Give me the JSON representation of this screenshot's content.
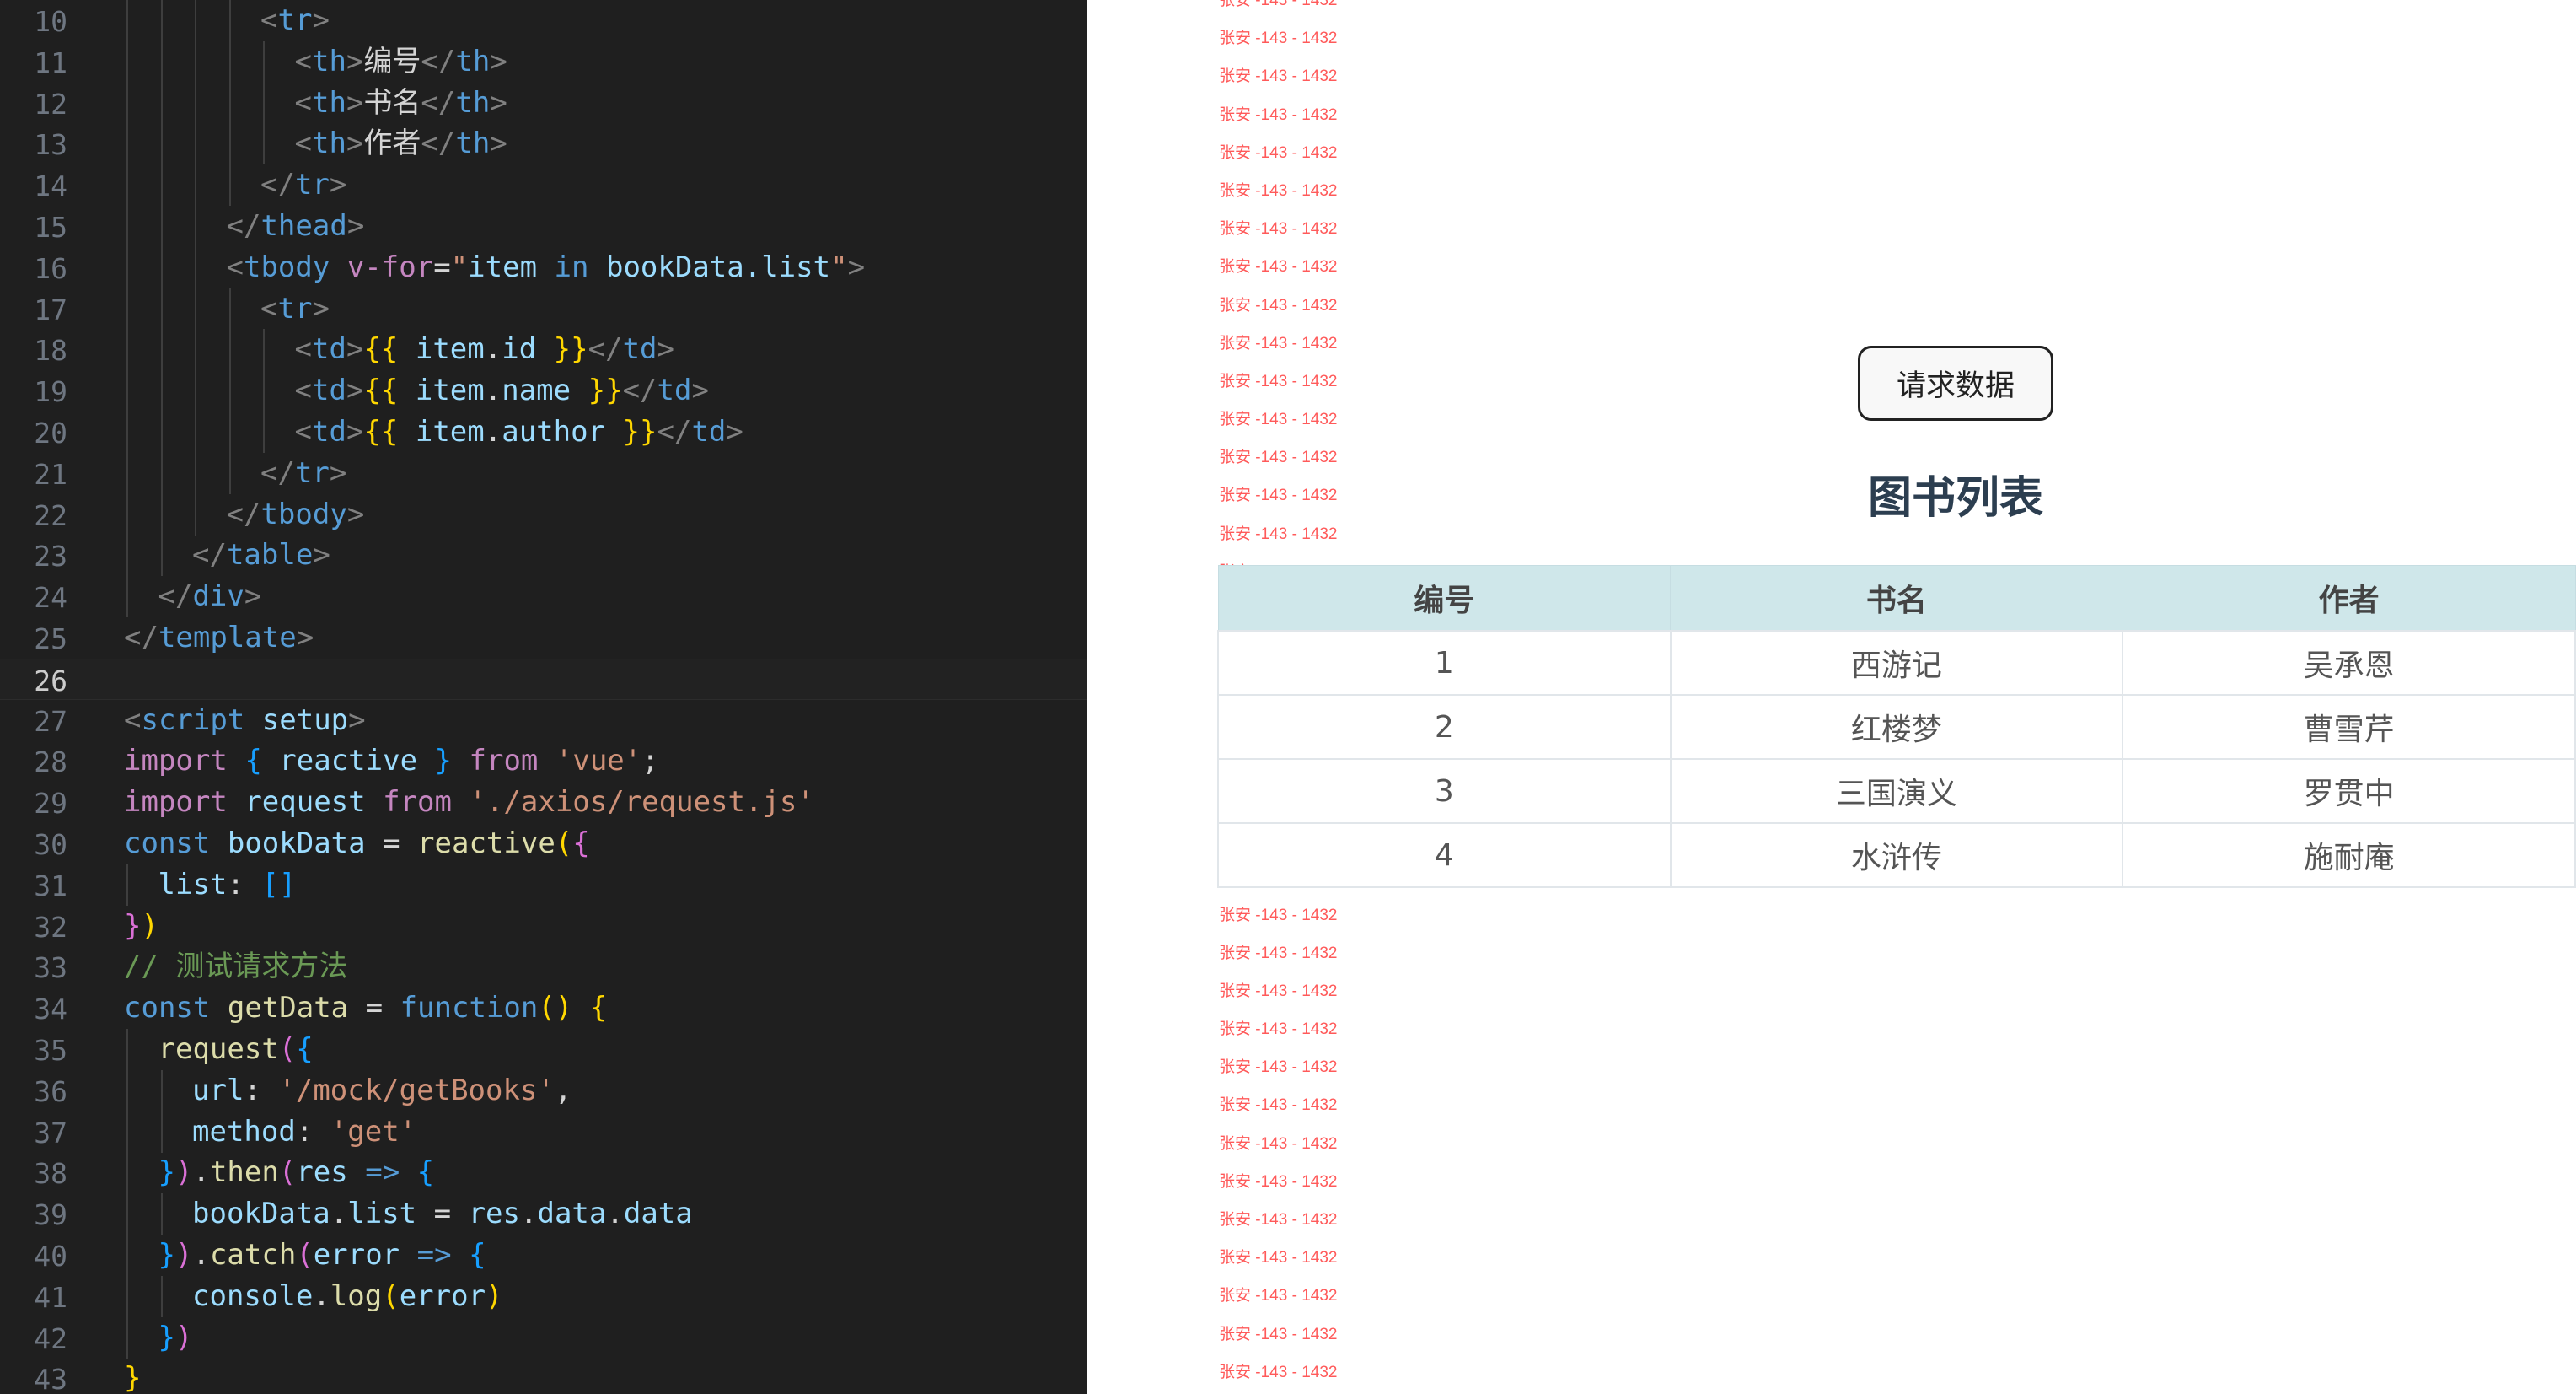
{
  "editor": {
    "lines": [
      {
        "n": "10",
        "indent": 0,
        "tokens": [
          [
            "bracket",
            "<"
          ],
          [
            "tag",
            "tr"
          ],
          [
            "bracket",
            ">"
          ]
        ]
      },
      {
        "n": "11",
        "indent": 0,
        "tokens": [
          [
            "bracket",
            "<"
          ],
          [
            "tag",
            "th"
          ],
          [
            "bracket",
            ">"
          ],
          [
            "plain",
            "编号"
          ],
          [
            "bracket",
            "</"
          ],
          [
            "tag",
            "th"
          ],
          [
            "bracket",
            ">"
          ]
        ]
      },
      {
        "n": "12",
        "indent": 0,
        "tokens": [
          [
            "bracket",
            "<"
          ],
          [
            "tag",
            "th"
          ],
          [
            "bracket",
            ">"
          ],
          [
            "plain",
            "书名"
          ],
          [
            "bracket",
            "</"
          ],
          [
            "tag",
            "th"
          ],
          [
            "bracket",
            ">"
          ]
        ]
      },
      {
        "n": "13",
        "indent": 0,
        "tokens": [
          [
            "bracket",
            "<"
          ],
          [
            "tag",
            "th"
          ],
          [
            "bracket",
            ">"
          ],
          [
            "plain",
            "作者"
          ],
          [
            "bracket",
            "</"
          ],
          [
            "tag",
            "th"
          ],
          [
            "bracket",
            ">"
          ]
        ]
      },
      {
        "n": "14",
        "indent": 0,
        "tokens": [
          [
            "bracket",
            "</"
          ],
          [
            "tag",
            "tr"
          ],
          [
            "bracket",
            ">"
          ]
        ]
      },
      {
        "n": "15",
        "indent": 0,
        "tokens": [
          [
            "bracket",
            "</"
          ],
          [
            "tag",
            "thead"
          ],
          [
            "bracket",
            ">"
          ]
        ]
      },
      {
        "n": "16",
        "indent": 0,
        "tokens": [
          [
            "bracket",
            "<"
          ],
          [
            "tag",
            "tbody"
          ],
          [
            "plain",
            " "
          ],
          [
            "dir",
            "v-for"
          ],
          [
            "plain",
            "="
          ],
          [
            "str",
            "\""
          ],
          [
            "attr",
            "item"
          ],
          [
            "plain",
            " "
          ],
          [
            "kw",
            "in"
          ],
          [
            "plain",
            " "
          ],
          [
            "attr",
            "bookData.list"
          ],
          [
            "str",
            "\""
          ],
          [
            "bracket",
            ">"
          ]
        ]
      },
      {
        "n": "17",
        "indent": 0,
        "tokens": [
          [
            "bracket",
            "<"
          ],
          [
            "tag",
            "tr"
          ],
          [
            "bracket",
            ">"
          ]
        ]
      },
      {
        "n": "18",
        "indent": 0,
        "tokens": [
          [
            "bracket",
            "<"
          ],
          [
            "tag",
            "td"
          ],
          [
            "bracket",
            ">"
          ],
          [
            "mustache",
            "{{"
          ],
          [
            "plain",
            " "
          ],
          [
            "prop",
            "item"
          ],
          [
            "plain",
            "."
          ],
          [
            "prop",
            "id"
          ],
          [
            "plain",
            " "
          ],
          [
            "mustache",
            "}}"
          ],
          [
            "bracket",
            "</"
          ],
          [
            "tag",
            "td"
          ],
          [
            "bracket",
            ">"
          ]
        ]
      },
      {
        "n": "19",
        "indent": 0,
        "tokens": [
          [
            "bracket",
            "<"
          ],
          [
            "tag",
            "td"
          ],
          [
            "bracket",
            ">"
          ],
          [
            "mustache",
            "{{"
          ],
          [
            "plain",
            " "
          ],
          [
            "prop",
            "item"
          ],
          [
            "plain",
            "."
          ],
          [
            "prop",
            "name"
          ],
          [
            "plain",
            " "
          ],
          [
            "mustache",
            "}}"
          ],
          [
            "bracket",
            "</"
          ],
          [
            "tag",
            "td"
          ],
          [
            "bracket",
            ">"
          ]
        ]
      },
      {
        "n": "20",
        "indent": 0,
        "tokens": [
          [
            "bracket",
            "<"
          ],
          [
            "tag",
            "td"
          ],
          [
            "bracket",
            ">"
          ],
          [
            "mustache",
            "{{"
          ],
          [
            "plain",
            " "
          ],
          [
            "prop",
            "item"
          ],
          [
            "plain",
            "."
          ],
          [
            "prop",
            "author"
          ],
          [
            "plain",
            " "
          ],
          [
            "mustache",
            "}}"
          ],
          [
            "bracket",
            "</"
          ],
          [
            "tag",
            "td"
          ],
          [
            "bracket",
            ">"
          ]
        ]
      },
      {
        "n": "21",
        "indent": 0,
        "tokens": [
          [
            "bracket",
            "</"
          ],
          [
            "tag",
            "tr"
          ],
          [
            "bracket",
            ">"
          ]
        ]
      },
      {
        "n": "22",
        "indent": 0,
        "tokens": [
          [
            "bracket",
            "</"
          ],
          [
            "tag",
            "tbody"
          ],
          [
            "bracket",
            ">"
          ]
        ]
      },
      {
        "n": "23",
        "indent": 0,
        "tokens": [
          [
            "bracket",
            "</"
          ],
          [
            "tag",
            "table"
          ],
          [
            "bracket",
            ">"
          ]
        ]
      },
      {
        "n": "24",
        "indent": 0,
        "tokens": [
          [
            "bracket",
            "</"
          ],
          [
            "tag",
            "div"
          ],
          [
            "bracket",
            ">"
          ]
        ]
      },
      {
        "n": "25",
        "indent": 0,
        "tokens": [
          [
            "bracket",
            "</"
          ],
          [
            "tag",
            "template"
          ],
          [
            "bracket",
            ">"
          ]
        ]
      },
      {
        "n": "26",
        "indent": 0,
        "tokens": []
      },
      {
        "n": "27",
        "indent": 0,
        "tokens": [
          [
            "bracket",
            "<"
          ],
          [
            "tag",
            "script"
          ],
          [
            "plain",
            " "
          ],
          [
            "attr",
            "setup"
          ],
          [
            "bracket",
            ">"
          ]
        ]
      },
      {
        "n": "28",
        "indent": 0,
        "tokens": [
          [
            "kw2",
            "import"
          ],
          [
            "plain",
            " "
          ],
          [
            "brace3",
            "{"
          ],
          [
            "plain",
            " "
          ],
          [
            "prop",
            "reactive"
          ],
          [
            "plain",
            " "
          ],
          [
            "brace3",
            "}"
          ],
          [
            "plain",
            " "
          ],
          [
            "kw2",
            "from"
          ],
          [
            "plain",
            " "
          ],
          [
            "str",
            "'vue'"
          ],
          [
            "plain",
            ";"
          ]
        ]
      },
      {
        "n": "29",
        "indent": 0,
        "tokens": [
          [
            "kw2",
            "import"
          ],
          [
            "plain",
            " "
          ],
          [
            "prop",
            "request"
          ],
          [
            "plain",
            " "
          ],
          [
            "kw2",
            "from"
          ],
          [
            "plain",
            " "
          ],
          [
            "str",
            "'./axios/request.js'"
          ]
        ]
      },
      {
        "n": "30",
        "indent": 0,
        "tokens": [
          [
            "kw",
            "const"
          ],
          [
            "plain",
            " "
          ],
          [
            "prop",
            "bookData"
          ],
          [
            "plain",
            " = "
          ],
          [
            "fn",
            "reactive"
          ],
          [
            "brace1",
            "("
          ],
          [
            "brace2",
            "{"
          ]
        ]
      },
      {
        "n": "31",
        "indent": 0,
        "tokens": [
          [
            "prop",
            "list"
          ],
          [
            "plain",
            ": "
          ],
          [
            "brace3",
            "[]"
          ]
        ]
      },
      {
        "n": "32",
        "indent": 0,
        "tokens": [
          [
            "brace2",
            "}"
          ],
          [
            "brace1",
            ")"
          ]
        ]
      },
      {
        "n": "33",
        "indent": 0,
        "tokens": [
          [
            "cmt",
            "// 测试请求方法"
          ]
        ]
      },
      {
        "n": "34",
        "indent": 0,
        "tokens": [
          [
            "kw",
            "const"
          ],
          [
            "plain",
            " "
          ],
          [
            "fn",
            "getData"
          ],
          [
            "plain",
            " = "
          ],
          [
            "kw",
            "function"
          ],
          [
            "brace1",
            "()"
          ],
          [
            "plain",
            " "
          ],
          [
            "brace1",
            "{"
          ]
        ]
      },
      {
        "n": "35",
        "indent": 0,
        "tokens": [
          [
            "fn",
            "request"
          ],
          [
            "brace2",
            "("
          ],
          [
            "brace3",
            "{"
          ]
        ]
      },
      {
        "n": "36",
        "indent": 0,
        "tokens": [
          [
            "prop",
            "url"
          ],
          [
            "plain",
            ": "
          ],
          [
            "str",
            "'/mock/getBooks'"
          ],
          [
            "plain",
            ","
          ]
        ]
      },
      {
        "n": "37",
        "indent": 0,
        "tokens": [
          [
            "prop",
            "method"
          ],
          [
            "plain",
            ": "
          ],
          [
            "str",
            "'get'"
          ]
        ]
      },
      {
        "n": "38",
        "indent": 0,
        "tokens": [
          [
            "brace3",
            "}"
          ],
          [
            "brace2",
            ")"
          ],
          [
            "plain",
            "."
          ],
          [
            "fn",
            "then"
          ],
          [
            "brace2",
            "("
          ],
          [
            "prop",
            "res"
          ],
          [
            "plain",
            " "
          ],
          [
            "kw",
            "=>"
          ],
          [
            "plain",
            " "
          ],
          [
            "brace3",
            "{"
          ]
        ]
      },
      {
        "n": "39",
        "indent": 0,
        "tokens": [
          [
            "prop",
            "bookData"
          ],
          [
            "plain",
            "."
          ],
          [
            "prop",
            "list"
          ],
          [
            "plain",
            " = "
          ],
          [
            "prop",
            "res"
          ],
          [
            "plain",
            "."
          ],
          [
            "prop",
            "data"
          ],
          [
            "plain",
            "."
          ],
          [
            "prop",
            "data"
          ]
        ]
      },
      {
        "n": "40",
        "indent": 0,
        "tokens": [
          [
            "brace3",
            "}"
          ],
          [
            "brace2",
            ")"
          ],
          [
            "plain",
            "."
          ],
          [
            "fn",
            "catch"
          ],
          [
            "brace2",
            "("
          ],
          [
            "prop",
            "error"
          ],
          [
            "plain",
            " "
          ],
          [
            "kw",
            "=>"
          ],
          [
            "plain",
            " "
          ],
          [
            "brace3",
            "{"
          ]
        ]
      },
      {
        "n": "41",
        "indent": 0,
        "tokens": [
          [
            "prop",
            "console"
          ],
          [
            "plain",
            "."
          ],
          [
            "fn",
            "log"
          ],
          [
            "brace1",
            "("
          ],
          [
            "prop",
            "error"
          ],
          [
            "brace1",
            ")"
          ]
        ]
      },
      {
        "n": "42",
        "indent": 0,
        "tokens": [
          [
            "brace3",
            "}"
          ],
          [
            "brace2",
            ")"
          ]
        ]
      },
      {
        "n": "43",
        "indent": 0,
        "tokens": [
          [
            "brace1",
            "}"
          ]
        ]
      }
    ]
  },
  "preview": {
    "watermark_text": "张安 -143 - 1432",
    "fetch_button_label": "请求数据",
    "title": "图书列表",
    "table": {
      "headers": [
        "编号",
        "书名",
        "作者"
      ],
      "rows": [
        [
          "1",
          "西游记",
          "吴承恩"
        ],
        [
          "2",
          "红楼梦",
          "曹雪芹"
        ],
        [
          "3",
          "三国演义",
          "罗贯中"
        ],
        [
          "4",
          "水浒传",
          "施耐庵"
        ]
      ]
    }
  }
}
